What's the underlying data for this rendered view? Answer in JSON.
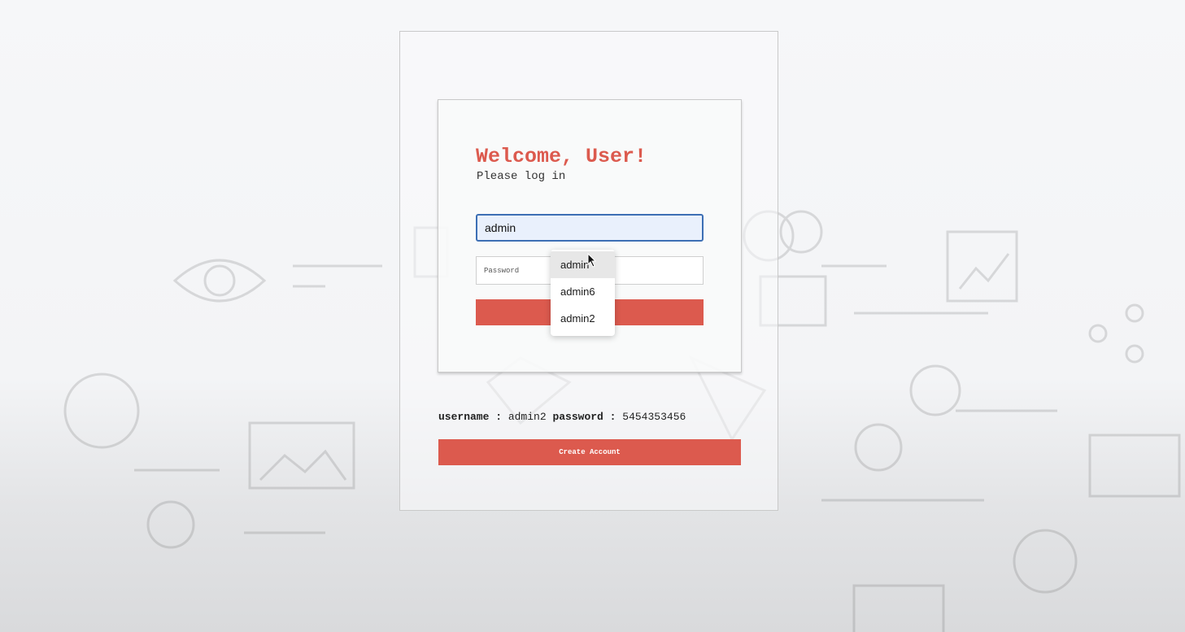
{
  "login": {
    "heading": "Welcome, User!",
    "subheading": "Please log in",
    "username_value": "admin",
    "password_placeholder": "Password",
    "login_button_label": ""
  },
  "autocomplete": {
    "items": [
      "admin",
      "admin6",
      "admin2"
    ],
    "highlighted_index": 0
  },
  "credentials": {
    "username_key": "username :",
    "username_value": "admin2",
    "password_key": "password :",
    "password_value": "5454353456"
  },
  "footer": {
    "create_account_label": "Create Account"
  },
  "colors": {
    "accent": "#dc5a4e",
    "focus_border": "#3d6fb4",
    "autofill_bg": "#e9f0fc"
  }
}
